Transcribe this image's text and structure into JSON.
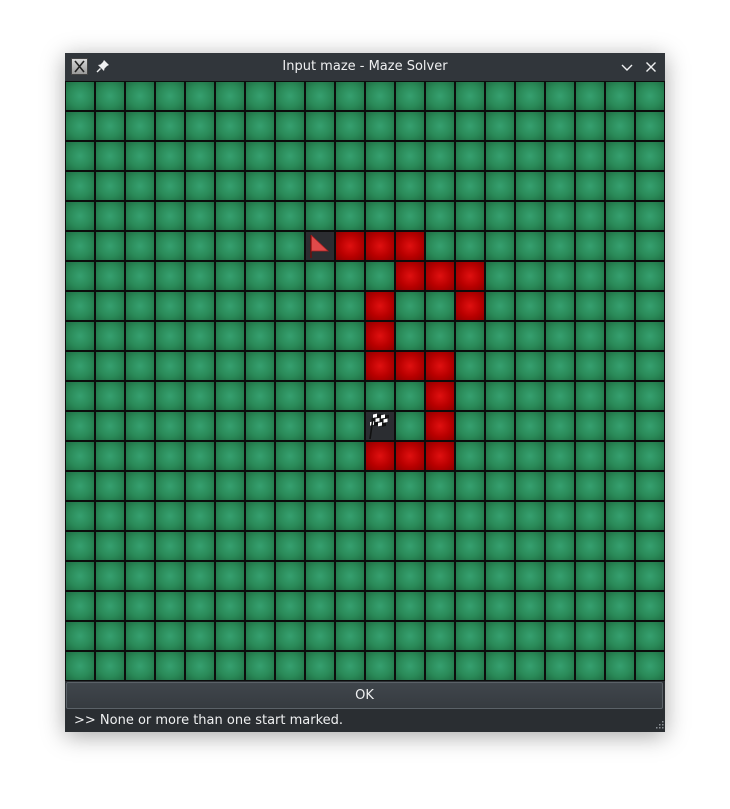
{
  "window": {
    "title": "Input maze - Maze Solver",
    "icons": [
      "app-icon",
      "pin-icon",
      "minimize-chevron-icon",
      "close-icon"
    ]
  },
  "maze": {
    "rows": 20,
    "cols": 20,
    "cell_colors": {
      "empty": "#2a8a58",
      "path": "#b80000",
      "flag": "#2b2d31"
    },
    "start": {
      "row": 5,
      "col": 8,
      "icon": "red-flag-icon"
    },
    "finish": {
      "row": 11,
      "col": 10,
      "icon": "checkered-flag-icon"
    },
    "path_cells": [
      [
        5,
        9
      ],
      [
        5,
        10
      ],
      [
        5,
        11
      ],
      [
        6,
        11
      ],
      [
        6,
        12
      ],
      [
        6,
        13
      ],
      [
        7,
        10
      ],
      [
        7,
        13
      ],
      [
        8,
        10
      ],
      [
        9,
        10
      ],
      [
        9,
        11
      ],
      [
        9,
        12
      ],
      [
        10,
        12
      ],
      [
        11,
        12
      ],
      [
        12,
        10
      ],
      [
        12,
        11
      ],
      [
        12,
        12
      ]
    ]
  },
  "ok_button": {
    "label": "OK"
  },
  "status": {
    "message": ">> None or more than one start marked."
  }
}
